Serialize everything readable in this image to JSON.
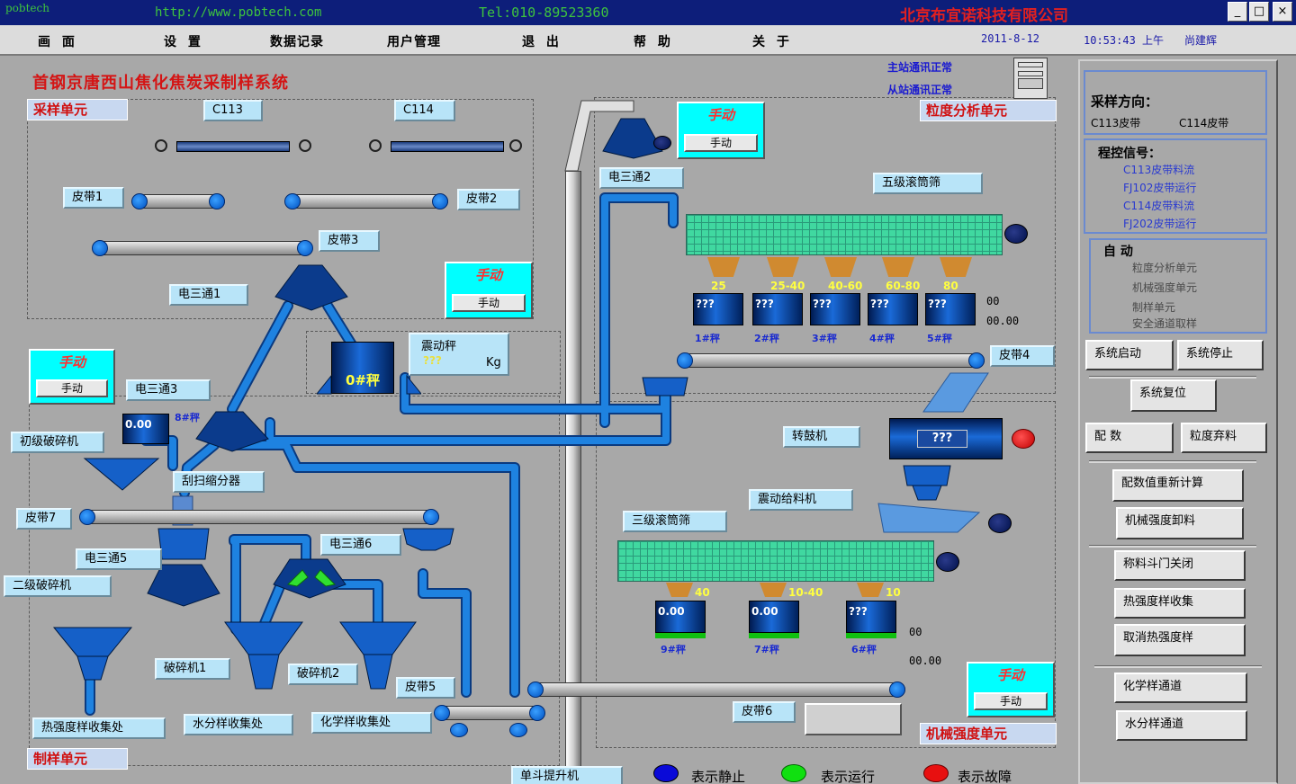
{
  "titlebar": {
    "brand": "pobtech",
    "url": "http://www.pobtech.com",
    "tel": "Tel:010-89523360",
    "company": "北京布宜诺科技有限公司",
    "min": "_",
    "max": "□",
    "close": "×"
  },
  "menu": {
    "items": [
      "画 面",
      "设 置",
      "数据记录",
      "用户管理",
      "退 出",
      "帮 助",
      "关 于"
    ],
    "date": "2011-8-12",
    "time": "10:53:43 上午",
    "user": "尚建辉"
  },
  "system_title": "首钢京唐西山焦化焦炭采制样系统",
  "comm": {
    "main": "主站通讯正常",
    "sub": "从站通讯正常"
  },
  "units": {
    "sampling": "采样单元",
    "granularity": "粒度分析单元",
    "preparation": "制样单元",
    "mech": "机械强度单元"
  },
  "labels": {
    "c113": "C113",
    "c114": "C114",
    "belt1": "皮带1",
    "belt2": "皮带2",
    "belt3": "皮带3",
    "belt4": "皮带4",
    "belt5": "皮带5",
    "belt6": "皮带6",
    "belt7": "皮带7",
    "tee1": "电三通1",
    "tee2": "电三通2",
    "tee3": "电三通3",
    "tee5": "电三通5",
    "tee6": "电三通6",
    "five_screen": "五级滚筒筛",
    "three_screen": "三级滚筒筛",
    "vib_scale": "震动秤",
    "vib_unit": "Kg",
    "vib_value": "???",
    "primary_crusher": "初级破碎机",
    "secondary_crusher": "二级破碎机",
    "divider": "刮扫缩分器",
    "crusher1": "破碎机1",
    "crusher2": "破碎机2",
    "drum": "转鼓机",
    "vib_feeder": "震动给料机",
    "heat_collect": "热强度样收集处",
    "water_collect": "水分样收集处",
    "chem_collect": "化学样收集处",
    "elevator": "单斗提升机",
    "scale0": "0#秤"
  },
  "manual": {
    "title": "手动",
    "button": "手动"
  },
  "five_bins": {
    "sizes": [
      "25",
      "25-40",
      "40-60",
      "60-80",
      "80"
    ],
    "values": [
      "???",
      "???",
      "???",
      "???",
      "???"
    ],
    "names": [
      "1#秤",
      "2#秤",
      "3#秤",
      "4#秤",
      "5#秤"
    ],
    "r1": "00",
    "r2": "00.00"
  },
  "three_bins": {
    "sizes": [
      "40",
      "10-40",
      "10"
    ],
    "values": [
      "0.00",
      "0.00",
      "???"
    ],
    "names": [
      "9#秤",
      "7#秤",
      "6#秤"
    ],
    "r1": "00",
    "r2": "00.00"
  },
  "primary_bin": {
    "value": "0.00",
    "name": "8#秤"
  },
  "drum_value": "???",
  "sidebar": {
    "dir_title": "采样方向：",
    "dir_a": "C113皮带",
    "dir_b": "C114皮带",
    "sig_title": "程控信号：",
    "signals": [
      "C113皮带料流",
      "FJ102皮带运行",
      "C114皮带料流",
      "FJ202皮带运行"
    ],
    "auto_title": "自 动",
    "auto_items": [
      "粒度分析单元",
      "机械强度单元",
      "制样单元",
      "安全通道取样"
    ],
    "btn_start": "系统启动",
    "btn_stop": "系统停止",
    "btn_reset": "系统复位",
    "btn_ratio": "配 数",
    "btn_gran": "粒度弃料",
    "btn_recalc": "配数值重新计算",
    "btn_mech_unload": "机械强度卸料",
    "btn_close_door": "称料斗门关闭",
    "btn_heat_collect": "热强度样收集",
    "btn_cancel_heat": "取消热强度样",
    "btn_chem": "化学样通道",
    "btn_water": "水分样通道"
  },
  "legend": {
    "static": "表示静止",
    "running": "表示运行",
    "fault": "表示故障"
  },
  "colors": {
    "static": "#0a0ad8",
    "running": "#10e010",
    "fault": "#e81010"
  }
}
